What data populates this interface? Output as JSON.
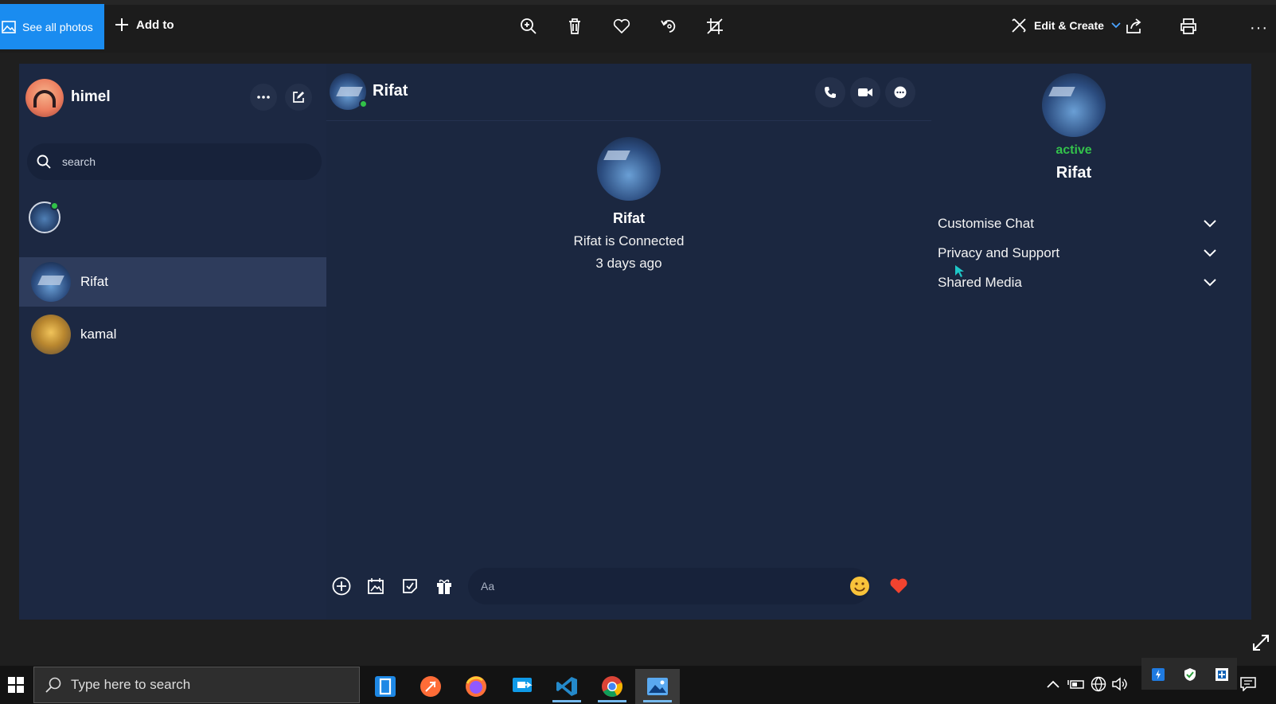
{
  "photos_toolbar": {
    "see_all_label": "See all photos",
    "add_to_label": "Add to",
    "edit_create_label": "Edit & Create",
    "icons": [
      "zoom-in-icon",
      "delete-icon",
      "favorite-icon",
      "rotate-icon",
      "crop-icon",
      "share-icon",
      "print-icon",
      "more-icon"
    ]
  },
  "messenger": {
    "user": {
      "name": "himel"
    },
    "search": {
      "placeholder": "search"
    },
    "contacts": [
      {
        "name": "Rifat",
        "active": true
      },
      {
        "name": "kamal",
        "active": false
      }
    ],
    "chat": {
      "name": "Rifat",
      "intro_name": "Rifat",
      "intro_status": "Rifat is Connected",
      "intro_time": "3 days ago"
    },
    "composer": {
      "placeholder": "Aa"
    },
    "info": {
      "status": "active",
      "name": "Rifat",
      "sections": [
        "Customise Chat",
        "Privacy and Support",
        "Shared Media"
      ]
    },
    "colors": {
      "background": "#1b2740",
      "online": "#31c148",
      "accent": "#1a8cf0"
    }
  },
  "taskbar": {
    "search_placeholder": "Type here to search",
    "apps": [
      "file-explorer-icon",
      "postman-icon",
      "firefox-icon",
      "remote-desktop-icon",
      "vscode-icon",
      "chrome-icon",
      "photos-icon"
    ]
  }
}
